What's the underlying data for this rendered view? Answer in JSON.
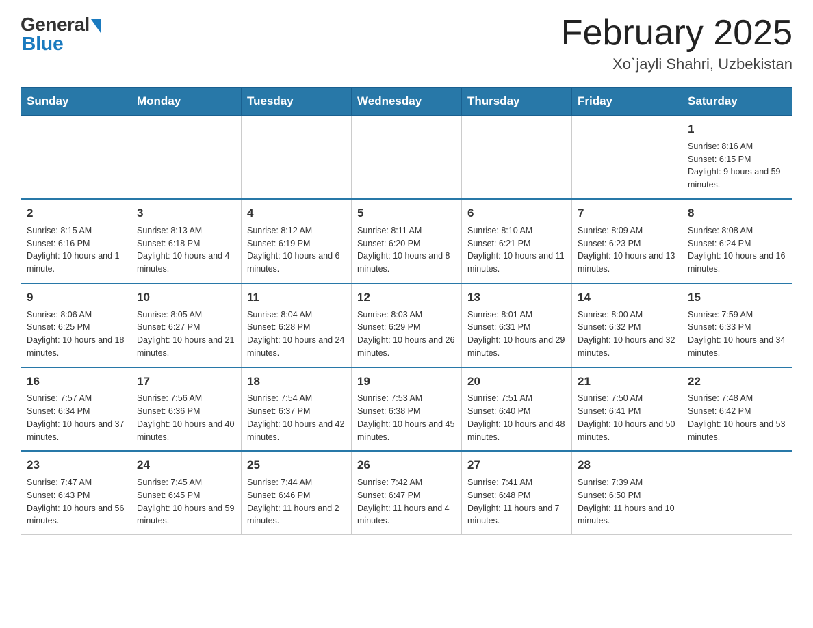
{
  "logo": {
    "general": "General",
    "blue": "Blue"
  },
  "title": "February 2025",
  "location": "Xo`jayli Shahri, Uzbekistan",
  "days_header": [
    "Sunday",
    "Monday",
    "Tuesday",
    "Wednesday",
    "Thursday",
    "Friday",
    "Saturday"
  ],
  "weeks": [
    [
      {
        "day": "",
        "info": ""
      },
      {
        "day": "",
        "info": ""
      },
      {
        "day": "",
        "info": ""
      },
      {
        "day": "",
        "info": ""
      },
      {
        "day": "",
        "info": ""
      },
      {
        "day": "",
        "info": ""
      },
      {
        "day": "1",
        "info": "Sunrise: 8:16 AM\nSunset: 6:15 PM\nDaylight: 9 hours and 59 minutes."
      }
    ],
    [
      {
        "day": "2",
        "info": "Sunrise: 8:15 AM\nSunset: 6:16 PM\nDaylight: 10 hours and 1 minute."
      },
      {
        "day": "3",
        "info": "Sunrise: 8:13 AM\nSunset: 6:18 PM\nDaylight: 10 hours and 4 minutes."
      },
      {
        "day": "4",
        "info": "Sunrise: 8:12 AM\nSunset: 6:19 PM\nDaylight: 10 hours and 6 minutes."
      },
      {
        "day": "5",
        "info": "Sunrise: 8:11 AM\nSunset: 6:20 PM\nDaylight: 10 hours and 8 minutes."
      },
      {
        "day": "6",
        "info": "Sunrise: 8:10 AM\nSunset: 6:21 PM\nDaylight: 10 hours and 11 minutes."
      },
      {
        "day": "7",
        "info": "Sunrise: 8:09 AM\nSunset: 6:23 PM\nDaylight: 10 hours and 13 minutes."
      },
      {
        "day": "8",
        "info": "Sunrise: 8:08 AM\nSunset: 6:24 PM\nDaylight: 10 hours and 16 minutes."
      }
    ],
    [
      {
        "day": "9",
        "info": "Sunrise: 8:06 AM\nSunset: 6:25 PM\nDaylight: 10 hours and 18 minutes."
      },
      {
        "day": "10",
        "info": "Sunrise: 8:05 AM\nSunset: 6:27 PM\nDaylight: 10 hours and 21 minutes."
      },
      {
        "day": "11",
        "info": "Sunrise: 8:04 AM\nSunset: 6:28 PM\nDaylight: 10 hours and 24 minutes."
      },
      {
        "day": "12",
        "info": "Sunrise: 8:03 AM\nSunset: 6:29 PM\nDaylight: 10 hours and 26 minutes."
      },
      {
        "day": "13",
        "info": "Sunrise: 8:01 AM\nSunset: 6:31 PM\nDaylight: 10 hours and 29 minutes."
      },
      {
        "day": "14",
        "info": "Sunrise: 8:00 AM\nSunset: 6:32 PM\nDaylight: 10 hours and 32 minutes."
      },
      {
        "day": "15",
        "info": "Sunrise: 7:59 AM\nSunset: 6:33 PM\nDaylight: 10 hours and 34 minutes."
      }
    ],
    [
      {
        "day": "16",
        "info": "Sunrise: 7:57 AM\nSunset: 6:34 PM\nDaylight: 10 hours and 37 minutes."
      },
      {
        "day": "17",
        "info": "Sunrise: 7:56 AM\nSunset: 6:36 PM\nDaylight: 10 hours and 40 minutes."
      },
      {
        "day": "18",
        "info": "Sunrise: 7:54 AM\nSunset: 6:37 PM\nDaylight: 10 hours and 42 minutes."
      },
      {
        "day": "19",
        "info": "Sunrise: 7:53 AM\nSunset: 6:38 PM\nDaylight: 10 hours and 45 minutes."
      },
      {
        "day": "20",
        "info": "Sunrise: 7:51 AM\nSunset: 6:40 PM\nDaylight: 10 hours and 48 minutes."
      },
      {
        "day": "21",
        "info": "Sunrise: 7:50 AM\nSunset: 6:41 PM\nDaylight: 10 hours and 50 minutes."
      },
      {
        "day": "22",
        "info": "Sunrise: 7:48 AM\nSunset: 6:42 PM\nDaylight: 10 hours and 53 minutes."
      }
    ],
    [
      {
        "day": "23",
        "info": "Sunrise: 7:47 AM\nSunset: 6:43 PM\nDaylight: 10 hours and 56 minutes."
      },
      {
        "day": "24",
        "info": "Sunrise: 7:45 AM\nSunset: 6:45 PM\nDaylight: 10 hours and 59 minutes."
      },
      {
        "day": "25",
        "info": "Sunrise: 7:44 AM\nSunset: 6:46 PM\nDaylight: 11 hours and 2 minutes."
      },
      {
        "day": "26",
        "info": "Sunrise: 7:42 AM\nSunset: 6:47 PM\nDaylight: 11 hours and 4 minutes."
      },
      {
        "day": "27",
        "info": "Sunrise: 7:41 AM\nSunset: 6:48 PM\nDaylight: 11 hours and 7 minutes."
      },
      {
        "day": "28",
        "info": "Sunrise: 7:39 AM\nSunset: 6:50 PM\nDaylight: 11 hours and 10 minutes."
      },
      {
        "day": "",
        "info": ""
      }
    ]
  ]
}
